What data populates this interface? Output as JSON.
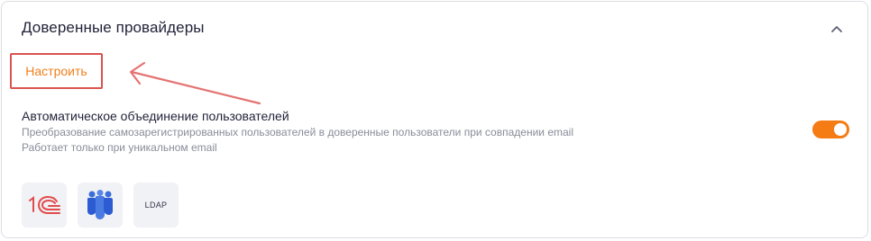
{
  "panel": {
    "title": "Доверенные провайдеры",
    "collapse_icon": "chevron-up-icon"
  },
  "configure_button": {
    "label": "Настроить"
  },
  "auto_merge": {
    "title": "Автоматическое объединение пользователей",
    "description_line1": "Преобразование самозарегистрированных пользователей в доверенные пользователи при совпадении email",
    "description_line2": "Работает только при уникальном email",
    "enabled": true
  },
  "providers": [
    {
      "icon": "1c-logo-icon"
    },
    {
      "icon": "people-logo-icon"
    },
    {
      "icon": "ldap-icon",
      "label": "LDAP"
    }
  ],
  "colors": {
    "accent": "#f57c14",
    "annotation": "#d9534f",
    "title_text": "#22243a",
    "muted_text": "#8a8c99",
    "tile_bg": "#f1f2f6"
  }
}
